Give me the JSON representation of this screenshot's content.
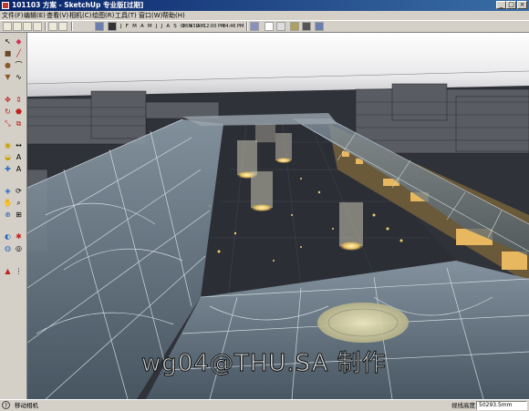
{
  "window": {
    "title": "101103 方案 - SketchUp 专业版[过期]",
    "minimize": "_",
    "maximize": "□",
    "close": "×"
  },
  "menu": [
    "文件(F)",
    "编辑(E)",
    "查看(V)",
    "相机(C)",
    "绘图(R)",
    "工具(T)",
    "窗口(W)",
    "帮助(H)"
  ],
  "shadow_settings": {
    "months": "J F M A M J J A S O N D",
    "time_start": "06:43 AM",
    "time_noon": "12:00 PM",
    "time_end": "04:46 PM"
  },
  "toolbar": {
    "icons": [
      "select-icon",
      "new-icon",
      "open-icon",
      "save-icon",
      "home-icon",
      "shadow-toggle-icon",
      "shadow-settings-icon",
      "xray-icon",
      "wireframe-icon",
      "hidden-line-icon",
      "shaded-icon",
      "textured-icon",
      "monochrome-icon"
    ]
  },
  "left_tools": [
    "select-icon",
    "eraser-icon",
    "rectangle-icon",
    "line-icon",
    "circle-icon",
    "arc-icon",
    "polygon-icon",
    "freehand-icon",
    "move-icon",
    "push-pull-icon",
    "rotate-icon",
    "follow-me-icon",
    "scale-icon",
    "offset-icon",
    "tape-measure-icon",
    "dimension-icon",
    "protractor-icon",
    "text-icon",
    "axes-icon",
    "3d-text-icon",
    "paint-bucket-icon",
    "orbit-icon",
    "pan-icon",
    "zoom-icon",
    "zoom-window-icon",
    "zoom-extents-icon",
    "previous-view-icon",
    "position-camera-icon",
    "walk-icon",
    "look-around-icon",
    "section-plane-icon",
    "footprint-icon"
  ],
  "viewport": {
    "watermark": "wg04@THU.SA 制作"
  },
  "status": {
    "message": "移动相机",
    "vcb_label": "视线高度",
    "vcb_value": "50293.5mm"
  }
}
